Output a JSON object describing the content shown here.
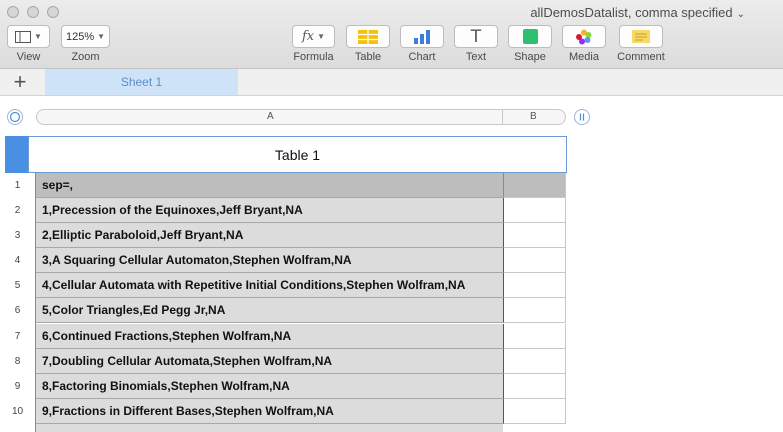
{
  "window": {
    "title": "allDemosDatalist, comma specified",
    "title_chevron": "⌄"
  },
  "toolbar": {
    "view_label": "View",
    "zoom_value": "125%",
    "zoom_label": "Zoom",
    "formula_icon": "fx",
    "formula_label": "Formula",
    "table_label": "Table",
    "chart_label": "Chart",
    "text_icon": "T",
    "text_label": "Text",
    "shape_label": "Shape",
    "media_label": "Media",
    "comment_label": "Comment"
  },
  "sheets": {
    "add_icon": "+",
    "tabs": [
      {
        "label": "Sheet 1"
      }
    ]
  },
  "table": {
    "title": "Table 1",
    "columns": [
      "A",
      "B"
    ],
    "rows": [
      {
        "num": "1",
        "a": "sep=,",
        "b": ""
      },
      {
        "num": "2",
        "a": "1,Precession of the Equinoxes,Jeff Bryant,NA",
        "b": ""
      },
      {
        "num": "3",
        "a": "2,Elliptic Paraboloid,Jeff Bryant,NA",
        "b": ""
      },
      {
        "num": "4",
        "a": "3,A Squaring Cellular Automaton,Stephen Wolfram,NA",
        "b": ""
      },
      {
        "num": "5",
        "a": "4,Cellular Automata with Repetitive Initial Conditions,Stephen Wolfram,NA",
        "b": ""
      },
      {
        "num": "6",
        "a": "5,Color Triangles,Ed Pegg Jr,NA",
        "b": ""
      },
      {
        "num": "7",
        "a": "6,Continued Fractions,Stephen Wolfram,NA",
        "b": ""
      },
      {
        "num": "8",
        "a": "7,Doubling Cellular Automata,Stephen Wolfram,NA",
        "b": ""
      },
      {
        "num": "9",
        "a": "8,Factoring Binomials,Stephen Wolfram,NA",
        "b": ""
      },
      {
        "num": "10",
        "a": "9,Fractions in Different Bases,Stephen Wolfram,NA",
        "b": ""
      }
    ]
  },
  "colors": {
    "accent": "#4a90e2",
    "sheet_tab": "#cfe3f8",
    "header_row": "#bdbdbd",
    "cell_fill": "#dcdcdc"
  }
}
